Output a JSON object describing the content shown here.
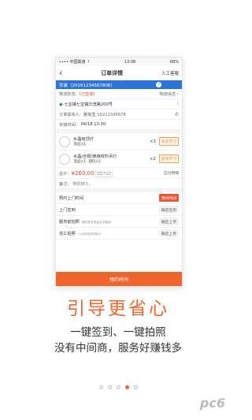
{
  "phone": {
    "status": {
      "carrier": "•••• 中国联通 ⇡",
      "time": "13:08",
      "battery": "68%"
    },
    "nav": {
      "back_icon": "‹",
      "title": "订单详情",
      "service": "人工客服"
    },
    "install_bar": {
      "label": "安装（20161234567806）",
      "badge": "?"
    },
    "logistics": {
      "label": "物流状态：",
      "status": "[已签收]",
      "link": "物流信息 ›"
    },
    "address": {
      "text": "七宝镇七宝镇华茂路200号",
      "chevron": "›"
    },
    "contact": {
      "label": "订单联系人：",
      "name": "张先生",
      "phone": "15212345678"
    },
    "install_time": {
      "label": "安装时间：",
      "value": "04/18 13:30"
    },
    "items": [
      {
        "name": "水晶吸顶灯",
        "tags": [
          "新品×1"
        ],
        "qty": "×1",
        "button": "安装学习"
      },
      {
        "name": "水晶/全铜/玻璃枝形吊灯",
        "tags": [
          "新品×1",
          "辅料×1"
        ],
        "qty": "×2",
        "button": "安装学习"
      }
    ],
    "total": {
      "label": "总计：",
      "amount": "¥260.00",
      "chip": "1工人×2",
      "link": "应付明细"
    },
    "remark": {
      "label": "备注：",
      "value": "带把梯子。"
    },
    "steps": [
      {
        "label": "预约上门时间",
        "note": "",
        "button": "预约时间",
        "primary": true
      },
      {
        "label": "上门签到",
        "note": "",
        "button": "确定签到",
        "primary": false
      },
      {
        "label": "服务前拍照",
        "note": "（要拍配件数量及完整度）",
        "button": "确定上传",
        "primary": false
      },
      {
        "label": "完工拍照",
        "note": "（上传安装完成照片）",
        "button": "确定上传",
        "primary": false
      }
    ],
    "bottom_button": "预约时间"
  },
  "headline": "引导更省心",
  "subline1": "一键签到、一键拍照",
  "subline2": "没有中间商，服务好赚钱多",
  "pager": {
    "count": 5,
    "active": 3
  },
  "watermark": "pc6",
  "colors": {
    "accent": "#f0652e",
    "blue": "#2e74d6"
  }
}
